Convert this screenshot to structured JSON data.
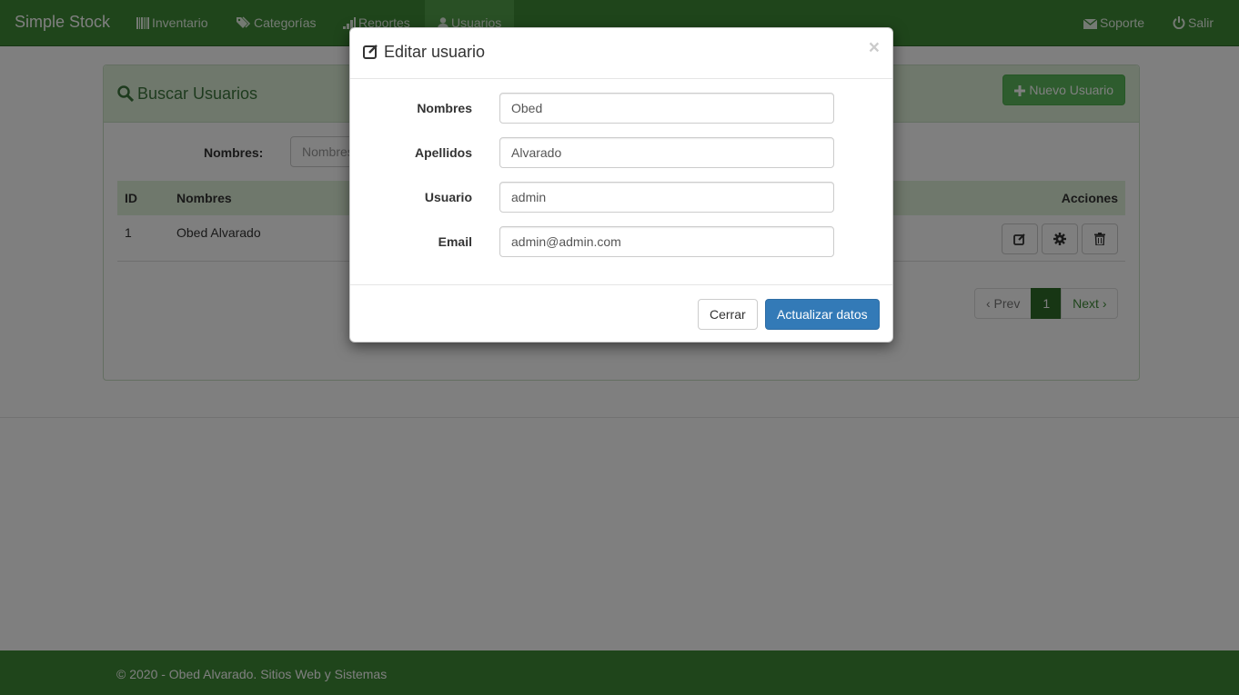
{
  "navbar": {
    "brand": "Simple Stock",
    "items": [
      {
        "label": "Inventario",
        "icon": "barcode-icon"
      },
      {
        "label": "Categorías",
        "icon": "tags-icon"
      },
      {
        "label": "Reportes",
        "icon": "signal-icon"
      },
      {
        "label": "Usuarios",
        "icon": "user-icon",
        "active": true
      }
    ],
    "right": [
      {
        "label": "Soporte",
        "icon": "envelope-icon"
      },
      {
        "label": "Salir",
        "icon": "power-icon"
      }
    ]
  },
  "panel": {
    "title": "Buscar Usuarios",
    "new_button": "Nuevo Usuario",
    "search_label": "Nombres:",
    "search_placeholder": "Nombres"
  },
  "table": {
    "columns": [
      "ID",
      "Nombres",
      "Acciones"
    ],
    "rows": [
      {
        "id": "1",
        "name": "Obed Alvarado"
      }
    ]
  },
  "pagination": {
    "prev": "‹ Prev",
    "current": "1",
    "next": "Next ›"
  },
  "footer": {
    "text": "© 2020 - Obed Alvarado. Sitios Web y Sistemas"
  },
  "modal": {
    "title": "Editar usuario",
    "close_symbol": "×",
    "fields": [
      {
        "label": "Nombres",
        "value": "Obed"
      },
      {
        "label": "Apellidos",
        "value": "Alvarado"
      },
      {
        "label": "Usuario",
        "value": "admin"
      },
      {
        "label": "Email",
        "value": "admin@admin.com"
      }
    ],
    "cancel_label": "Cerrar",
    "submit_label": "Actualizar datos"
  },
  "colors": {
    "brand_green": "#3e8a37",
    "primary_blue": "#337ab7",
    "success_green": "#5cb85c"
  }
}
